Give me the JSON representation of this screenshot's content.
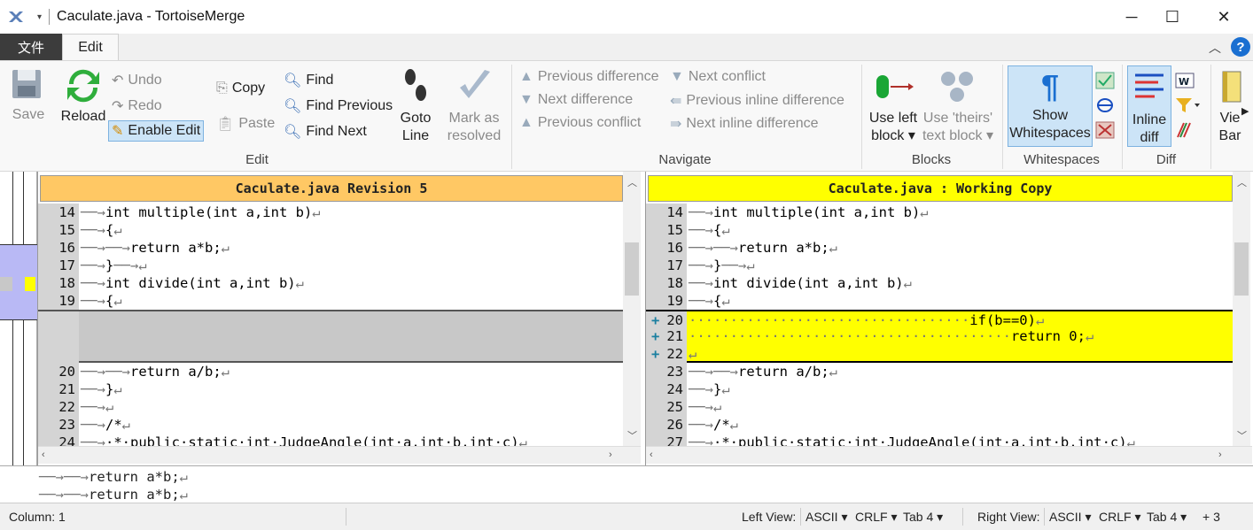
{
  "window": {
    "title": "Caculate.java - TortoiseMerge"
  },
  "tabs": {
    "file": "文件",
    "edit": "Edit"
  },
  "ribbon": {
    "save": "Save",
    "reload": "Reload",
    "undo": "Undo",
    "redo": "Redo",
    "enable_edit": "Enable Edit",
    "copy": "Copy",
    "paste": "Paste",
    "find": "Find",
    "find_previous": "Find Previous",
    "find_next": "Find Next",
    "goto_line_1": "Goto",
    "goto_line_2": "Line",
    "mark_resolved_1": "Mark as",
    "mark_resolved_2": "resolved",
    "edit_group": "Edit",
    "prev_difference": "Previous difference",
    "next_difference": "Next difference",
    "prev_conflict": "Previous conflict",
    "next_conflict": "Next conflict",
    "prev_inline": "Previous inline difference",
    "next_inline": "Next inline difference",
    "navigate_group": "Navigate",
    "use_left_1": "Use left",
    "use_left_2": "block",
    "use_theirs_1": "Use 'theirs'",
    "use_theirs_2": "text block",
    "blocks_group": "Blocks",
    "show_ws_1": "Show",
    "show_ws_2": "Whitespaces",
    "whitespaces_group": "Whitespaces",
    "inline_diff_1": "Inline",
    "inline_diff_2": "diff",
    "diff_group": "Diff",
    "view_bar_1": "Vie",
    "view_bar_2": "Bar"
  },
  "left_pane": {
    "header": "Caculate.java Revision 5",
    "header_color": "#ffc864",
    "lines": [
      {
        "num": "14",
        "ws": "──→",
        "code": "int multiple(int a,int b)",
        "end": "↵"
      },
      {
        "num": "15",
        "ws": "──→",
        "code": "{",
        "end": "↵"
      },
      {
        "num": "16",
        "ws": "──→──→",
        "code": "return a*b;",
        "end": "↵"
      },
      {
        "num": "17",
        "ws": "──→",
        "code": "}",
        "end": "──→↵"
      },
      {
        "num": "18",
        "ws": "──→",
        "code": "int divide(int a,int b)",
        "end": "↵"
      },
      {
        "num": "19",
        "ws": "──→",
        "code": "{",
        "end": "↵"
      },
      {
        "num": "",
        "ws": "",
        "code": "",
        "end": ""
      },
      {
        "num": "",
        "ws": "",
        "code": "",
        "end": ""
      },
      {
        "num": "",
        "ws": "",
        "code": "",
        "end": ""
      },
      {
        "num": "20",
        "ws": "──→──→",
        "code": "return a/b;",
        "end": "↵"
      },
      {
        "num": "21",
        "ws": "──→",
        "code": "}",
        "end": "↵"
      },
      {
        "num": "22",
        "ws": "──→",
        "code": "",
        "end": "↵"
      },
      {
        "num": "23",
        "ws": "──→",
        "code": "/*",
        "end": "↵"
      },
      {
        "num": "24",
        "ws": "──→",
        "code": "·*·public·static·int·JudgeAngle(int·a,int·b,int·c)",
        "end": "↵"
      }
    ]
  },
  "right_pane": {
    "header": "Caculate.java : Working Copy",
    "header_color": "#ffff00",
    "lines": [
      {
        "num": "14",
        "mark": "",
        "ws": "──→",
        "code": "int multiple(int a,int b)",
        "end": "↵"
      },
      {
        "num": "15",
        "mark": "",
        "ws": "──→",
        "code": "{",
        "end": "↵"
      },
      {
        "num": "16",
        "mark": "",
        "ws": "──→──→",
        "code": "return a*b;",
        "end": "↵"
      },
      {
        "num": "17",
        "mark": "",
        "ws": "──→",
        "code": "}",
        "end": "──→↵"
      },
      {
        "num": "18",
        "mark": "",
        "ws": "──→",
        "code": "int divide(int a,int b)",
        "end": "↵"
      },
      {
        "num": "19",
        "mark": "",
        "ws": "──→",
        "code": "{",
        "end": "↵"
      },
      {
        "num": "20",
        "mark": "+",
        "ws": "··································",
        "code": "if(b==0)",
        "end": "↵"
      },
      {
        "num": "21",
        "mark": "+",
        "ws": "·······································",
        "code": "return 0;",
        "end": "↵"
      },
      {
        "num": "22",
        "mark": "+",
        "ws": "",
        "code": "",
        "end": "↵"
      },
      {
        "num": "23",
        "mark": "",
        "ws": "──→──→",
        "code": "return a/b;",
        "end": "↵"
      },
      {
        "num": "24",
        "mark": "",
        "ws": "──→",
        "code": "}",
        "end": "↵"
      },
      {
        "num": "25",
        "mark": "",
        "ws": "──→",
        "code": "",
        "end": "↵"
      },
      {
        "num": "26",
        "mark": "",
        "ws": "──→",
        "code": "/*",
        "end": "↵"
      },
      {
        "num": "27",
        "mark": "",
        "ws": "──→",
        "code": "·*·public·static·int·JudgeAngle(int·a,int·b,int·c)",
        "end": "↵"
      }
    ]
  },
  "preview": {
    "line1": {
      "ws": "──→──→",
      "code": "return a*b;",
      "end": "↵"
    },
    "line2": {
      "ws": "──→──→",
      "code": "return a*b;",
      "end": "↵"
    }
  },
  "status": {
    "column": "Column: 1",
    "left_view": "Left View:",
    "left_encoding": "ASCII",
    "left_eol": "CRLF",
    "left_tab": "Tab 4",
    "right_view": "Right View:",
    "right_encoding": "ASCII",
    "right_eol": "CRLF",
    "right_tab": "Tab 4",
    "diff_count": "+ 3"
  },
  "colors": {
    "added": "#ffff00",
    "empty_block": "#c8c8c8",
    "gutter": "#d4d4d4",
    "selected": "#cce4f7"
  }
}
